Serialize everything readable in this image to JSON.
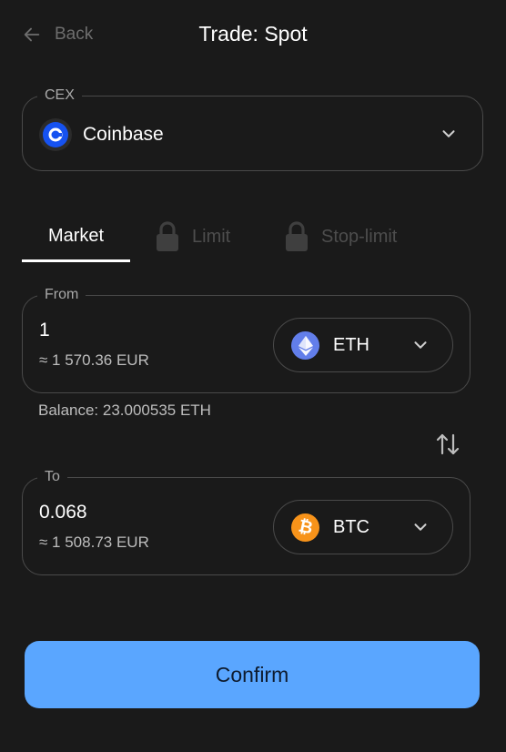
{
  "header": {
    "back_label": "Back",
    "title": "Trade: Spot"
  },
  "cex": {
    "legend": "CEX",
    "selected": "Coinbase",
    "logo_icon": "coinbase-logo"
  },
  "tabs": [
    {
      "label": "Market",
      "active": true,
      "locked": false
    },
    {
      "label": "Limit",
      "active": false,
      "locked": true
    },
    {
      "label": "Stop-limit",
      "active": false,
      "locked": true
    }
  ],
  "from": {
    "legend": "From",
    "amount": "1",
    "fiat": "≈ 1 570.36 EUR",
    "token": "ETH",
    "token_icon": "ethereum-icon"
  },
  "balance": "Balance: 23.000535 ETH",
  "to": {
    "legend": "To",
    "amount": "0.068",
    "fiat": "≈ 1 508.73 EUR",
    "token": "BTC",
    "token_icon": "bitcoin-icon"
  },
  "confirm_label": "Confirm",
  "colors": {
    "background": "#1a1a1a",
    "accent": "#5aa6ff",
    "coinbase": "#1652f0",
    "eth": "#627eea",
    "btc": "#f7931a"
  }
}
